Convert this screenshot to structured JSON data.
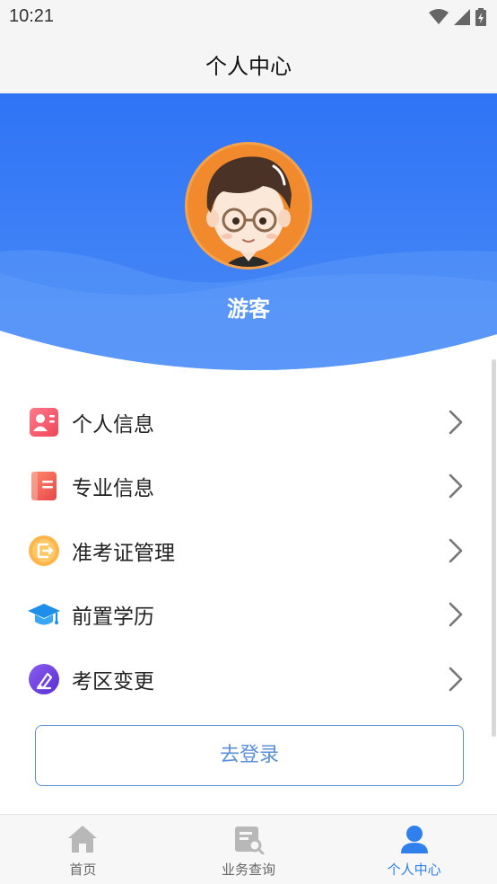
{
  "status_bar": {
    "time": "10:21"
  },
  "header": {
    "title": "个人中心"
  },
  "profile": {
    "username": "游客"
  },
  "menu": {
    "items": [
      {
        "label": "个人信息",
        "icon": "id-card-icon"
      },
      {
        "label": "专业信息",
        "icon": "book-icon"
      },
      {
        "label": "准考证管理",
        "icon": "admission-ticket-icon"
      },
      {
        "label": "前置学历",
        "icon": "graduation-cap-icon"
      },
      {
        "label": "考区变更",
        "icon": "edit-pen-icon"
      }
    ]
  },
  "login_button": {
    "label": "去登录"
  },
  "tab_bar": {
    "tabs": [
      {
        "label": "首页",
        "icon": "home-icon",
        "active": false
      },
      {
        "label": "业务查询",
        "icon": "query-icon",
        "active": false
      },
      {
        "label": "个人中心",
        "icon": "user-icon",
        "active": true
      }
    ]
  },
  "colors": {
    "accent": "#2f80ed",
    "hero": "#3478f6",
    "avatar_bg": "#f08a2c"
  }
}
